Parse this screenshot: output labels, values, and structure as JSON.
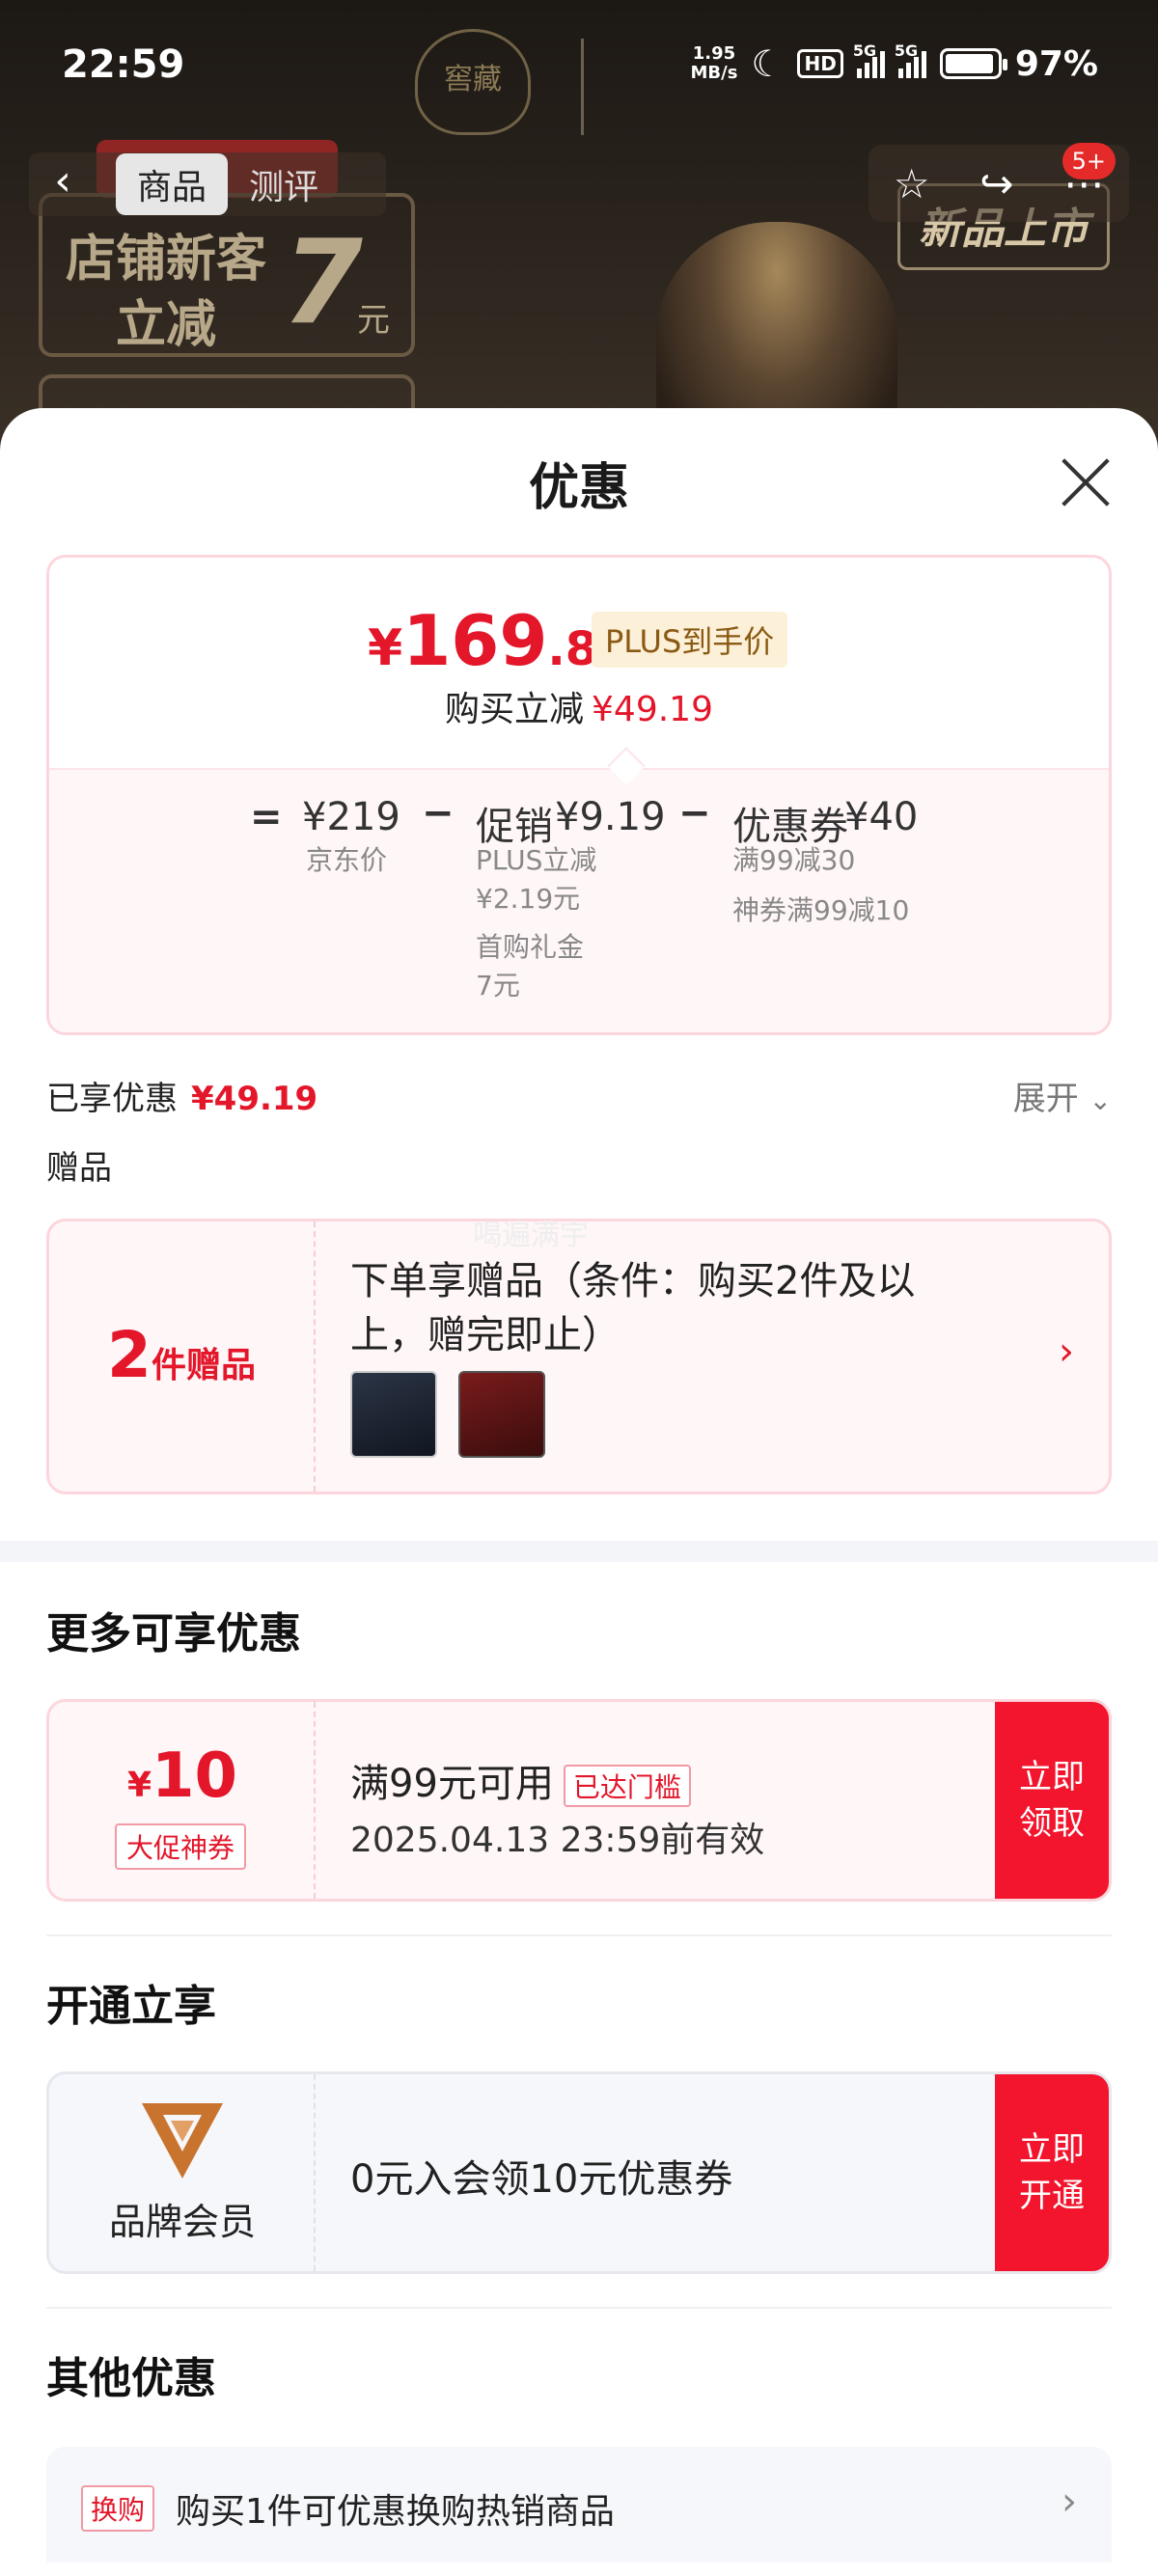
{
  "status_bar": {
    "time": "22:59",
    "net_speed_value": "1.95",
    "net_speed_unit": "MB/s",
    "hd": "HD",
    "signal1": "5G",
    "signal2": "5G",
    "battery": "97%"
  },
  "background": {
    "tabs": [
      {
        "label": "商品"
      },
      {
        "label": "测评"
      }
    ],
    "notif_badge": "5+",
    "promo_line1": "店铺新客",
    "promo_line2": "立减",
    "promo_num": "7",
    "promo_unit": "元",
    "new_badge": "新品上市"
  },
  "sheet": {
    "title": "优惠",
    "price": {
      "currency": "¥",
      "integer": "169",
      "decimal": ".81",
      "plus_tag": "PLUS到手价",
      "sub_label": "购买立减",
      "sub_value": "¥49.19"
    },
    "breakdown": {
      "eq": "=",
      "minus": "−",
      "jd_price": "¥219",
      "jd_caption": "京东价",
      "promo_label": "促销",
      "promo_value": "¥9.19",
      "promo_line1": "PLUS立减",
      "promo_line2": "¥2.19元",
      "promo_line3": "首购礼金",
      "promo_line4": "7元",
      "coupon_label": "优惠券",
      "coupon_value": "¥40",
      "coupon_line1": "满99减30",
      "coupon_line2": "神券满99减10"
    },
    "enjoyed_label": "已享优惠",
    "enjoyed_value": "¥49.19",
    "expand_label": "展开",
    "gift_label": "赠品",
    "gift": {
      "count": "2",
      "unit": "件赠品",
      "desc": "下单享赠品（条件：购买2件及以上，赠完即止）",
      "watermark": "喝遍满宇"
    },
    "more_title": "更多可享优惠",
    "coupon": {
      "currency": "¥",
      "amount": "10",
      "tag": "大促神券",
      "condition": "满99元可用",
      "badge": "已达门槛",
      "expiry": "2025.04.13 23:59前有效",
      "btn_line1": "立即",
      "btn_line2": "领取"
    },
    "open_title": "开通立享",
    "member": {
      "name": "品牌会员",
      "text": "0元入会领10元优惠券",
      "btn_line1": "立即",
      "btn_line2": "开通"
    },
    "other_title": "其他优惠",
    "other": {
      "tag": "换购",
      "text": "购买1件可优惠换购热销商品"
    }
  },
  "colors": {
    "accent_red": "#e3162a",
    "button_red": "#f2152d",
    "member_logo": "#c9742e"
  }
}
